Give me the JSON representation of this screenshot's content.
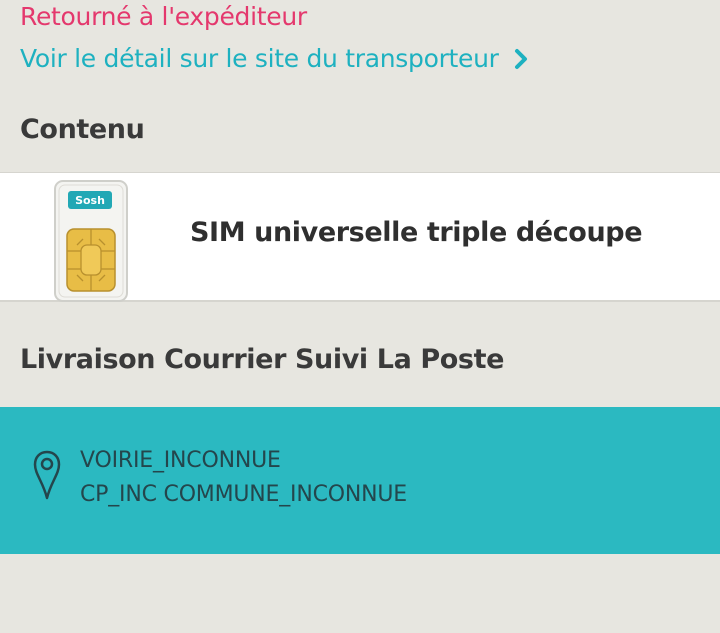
{
  "tracking": {
    "status": "Retourné à l'expéditeur",
    "carrier_link": "Voir le détail sur le site du transporteur"
  },
  "content_section": {
    "title": "Contenu",
    "items": [
      {
        "name": "SIM universelle triple découpe",
        "image_brand": "Sosh"
      }
    ]
  },
  "delivery": {
    "title": "Livraison Courrier Suivi La Poste",
    "address_line1": "VOIRIE_INCONNUE",
    "address_line2": "CP_INC COMMUNE_INCONNUE"
  },
  "colors": {
    "status": "#e4386d",
    "link": "#1eb1c0",
    "address_bg": "#2bb9c1",
    "page_bg": "#e7e6e0"
  },
  "icons": [
    "chevron-right-icon",
    "location-pin-icon",
    "sim-card-image"
  ]
}
